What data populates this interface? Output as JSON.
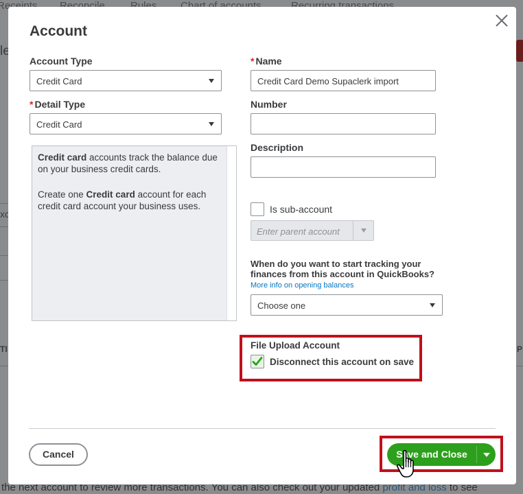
{
  "background": {
    "tabs": [
      "Receipts",
      "Reconcile",
      "Rules",
      "Chart of accounts",
      "Recurring transactions"
    ],
    "fragment_left_top": "le",
    "fragment_left_mid": "xc",
    "fragment_left_col": "TI",
    "fragment_right_col": "P",
    "footer_text": "the next account to review more transactions. You can also check out your updated ",
    "footer_link": "profit and loss",
    "footer_tail": " to see"
  },
  "dialog": {
    "title": "Account",
    "close_icon": "close-icon",
    "account_type": {
      "label": "Account Type",
      "value": "Credit Card"
    },
    "detail_type": {
      "required_mark": "*",
      "label": "Detail Type",
      "value": "Credit Card"
    },
    "info": {
      "p1_bold": "Credit card",
      "p1_rest": " accounts track the balance due on your business credit cards.",
      "p2_pre": "Create one ",
      "p2_bold": "Credit card",
      "p2_rest": " account for each credit card account your business uses."
    },
    "name": {
      "required_mark": "*",
      "label": "Name",
      "value": "Credit Card Demo Supaclerk import"
    },
    "number": {
      "label": "Number",
      "value": ""
    },
    "description": {
      "label": "Description",
      "value": ""
    },
    "sub_account": {
      "label": "Is sub-account",
      "checked": false,
      "parent_placeholder": "Enter parent account"
    },
    "opening_balance": {
      "question": "When do you want to start tracking your finances from this account in QuickBooks?",
      "link": "More info on opening balances",
      "select_value": "Choose one"
    },
    "file_upload": {
      "heading": "File Upload Account",
      "checkbox_label": "Disconnect this account on save",
      "checked": true
    },
    "footer": {
      "cancel_label": "Cancel",
      "save_label": "Save and Close"
    }
  },
  "colors": {
    "primary_green": "#2ca01c",
    "highlight_red": "#c0101a",
    "required_red": "#d52b1e",
    "link_blue": "#0077c5"
  }
}
